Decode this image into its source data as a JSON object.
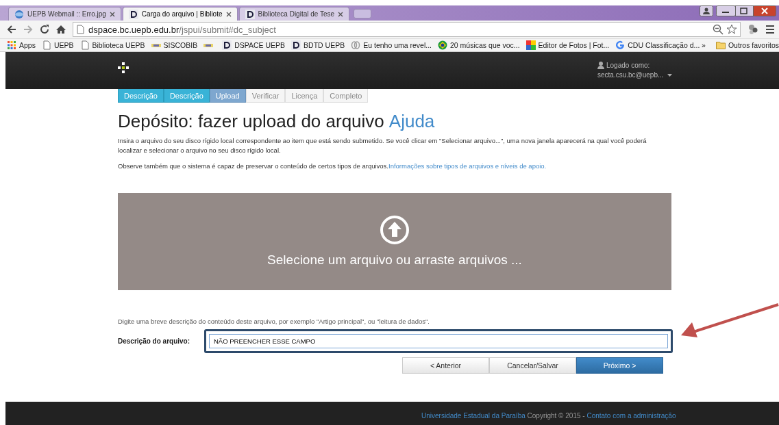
{
  "browser": {
    "tabs": [
      {
        "title": "UEPB Webmail :: Erro.jpg",
        "selected": false
      },
      {
        "title": "Carga do arquivo | Bibliote",
        "selected": true
      },
      {
        "title": "Biblioteca Digital de Tese",
        "selected": false
      }
    ],
    "address": {
      "host": "dspace.bc.uepb.edu.br",
      "path": "/jspui/submit#dc_subject"
    },
    "bookmarks": [
      {
        "label": "Apps",
        "kind": "labeled"
      },
      {
        "label": "UEPB",
        "kind": "labeled"
      },
      {
        "label": "Biblioteca UEPB",
        "kind": "labeled"
      },
      {
        "label": "SISCOBIB",
        "kind": "labeled"
      },
      {
        "kind": "icon_only"
      },
      {
        "label": "DSPACE UEPB",
        "kind": "labeled"
      },
      {
        "label": "BDTD UEPB",
        "kind": "labeled"
      },
      {
        "label": "Eu tenho uma revel...",
        "kind": "labeled"
      },
      {
        "label": "20 músicas que voc...",
        "kind": "labeled"
      },
      {
        "label": "Editor de Fotos | Fot...",
        "kind": "labeled"
      },
      {
        "label": "CDU Classificação d...",
        "kind": "labeled"
      }
    ],
    "more": "»",
    "other_bookmarks": "Outros favoritos"
  },
  "navbar": {
    "user_label": "Logado como:",
    "user": "secta.csu.bc@uepb..."
  },
  "steps": [
    {
      "label": "Descrição",
      "kind": "done"
    },
    {
      "label": "Descrição",
      "kind": "done"
    },
    {
      "label": "Upload",
      "kind": "current"
    },
    {
      "label": "Verificar",
      "kind": "todo"
    },
    {
      "label": "Licença",
      "kind": "todo"
    },
    {
      "label": "Completo",
      "kind": "todo"
    }
  ],
  "heading": {
    "title": "Depósito: fazer upload do arquivo",
    "help": "Ajuda"
  },
  "intro": "Insira o arquivo do seu disco rígido local correspondente ao item que está sendo submetido. Se você clicar em \"Selecionar arquivo...\", uma nova janela aparecerá na qual você poderá localizar e selecionar o arquivo no seu disco rígido local.",
  "note": {
    "text": "Observe também que o sistema é capaz de preservar o conteúdo de certos tipos de arquivos.",
    "link": "Informações sobre tipos de arquivos e níveis de apoio."
  },
  "dropzone": "Selecione um arquivo ou arraste arquivos ...",
  "hint": "Digite uma breve descrição do conteúdo deste arquivo, por exemplo \"Artigo principal\", ou \"leitura de dados\".",
  "field": {
    "label": "Descrição do arquivo:",
    "value": "NÃO PREENCHER ESSE CAMPO",
    "highlighted": true
  },
  "buttons": [
    {
      "label": "< Anterior",
      "kind": "default"
    },
    {
      "label": "Cancelar/Salvar",
      "kind": "default"
    },
    {
      "label": "Próximo >",
      "kind": "primary"
    }
  ],
  "footer": {
    "org": "Universidade Estadual da Paraíba",
    "copyright": "Copyright © 2015 -",
    "contact": "Contato com a administração"
  },
  "annotation_arrow": true
}
